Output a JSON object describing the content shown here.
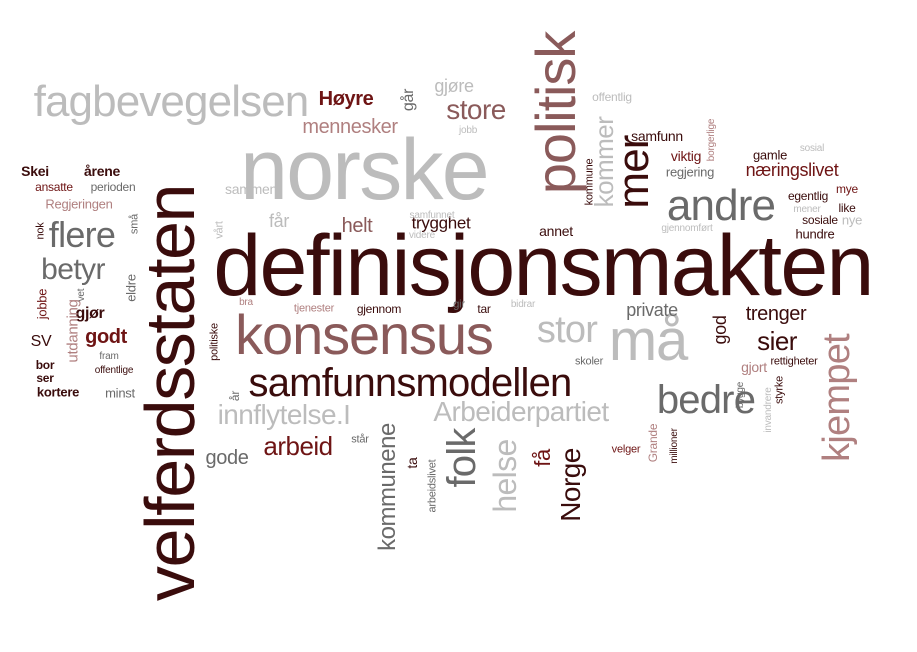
{
  "palette": {
    "dark": "#3a0c0c",
    "maroon": "#6e1414",
    "mauve": "#8a5a5a",
    "rose": "#b08080",
    "gray": "#6a6a6a",
    "light": "#bcbcbc"
  },
  "words": [
    {
      "text": "definisjonsmakten",
      "color": "dark"
    },
    {
      "text": "velferdsstaten",
      "color": "dark"
    },
    {
      "text": "norske",
      "color": "light"
    },
    {
      "text": "politisk",
      "color": "mauve"
    },
    {
      "text": "konsensus",
      "color": "mauve"
    },
    {
      "text": "samfunnsmodellen",
      "color": "dark"
    },
    {
      "text": "fagbevegelsen",
      "color": "light"
    },
    {
      "text": "andre",
      "color": "gray"
    },
    {
      "text": "mer",
      "color": "dark"
    },
    {
      "text": "kommer",
      "color": "light"
    },
    {
      "text": "stor",
      "color": "light"
    },
    {
      "text": "må",
      "color": "light"
    },
    {
      "text": "bedre",
      "color": "gray"
    },
    {
      "text": "kjempet",
      "color": "rose"
    },
    {
      "text": "flere",
      "color": "gray"
    },
    {
      "text": "betyr",
      "color": "gray"
    },
    {
      "text": "innflytelse.I",
      "color": "light"
    },
    {
      "text": "Arbeiderpartiet",
      "color": "light"
    },
    {
      "text": "arbeid",
      "color": "maroon"
    },
    {
      "text": "folk",
      "color": "gray"
    },
    {
      "text": "kommunene",
      "color": "gray"
    },
    {
      "text": "helse",
      "color": "light"
    },
    {
      "text": "Norge",
      "color": "dark"
    },
    {
      "text": "sier",
      "color": "dark"
    },
    {
      "text": "trenger",
      "color": "dark"
    },
    {
      "text": "Høyre",
      "color": "maroon"
    },
    {
      "text": "mennesker",
      "color": "rose"
    },
    {
      "text": "store",
      "color": "mauve"
    },
    {
      "text": "gjøre",
      "color": "light"
    },
    {
      "text": "går",
      "color": "gray"
    },
    {
      "text": "offentlig",
      "color": "light"
    },
    {
      "text": "helt",
      "color": "mauve"
    },
    {
      "text": "trygghet",
      "color": "dark"
    },
    {
      "text": "annet",
      "color": "dark"
    },
    {
      "text": "samfunnet",
      "color": "light"
    },
    {
      "text": "videre",
      "color": "light"
    },
    {
      "text": "får",
      "color": "light"
    },
    {
      "text": "sammen",
      "color": "light"
    },
    {
      "text": "vårt",
      "color": "light"
    },
    {
      "text": "Skei",
      "color": "dark"
    },
    {
      "text": "årene",
      "color": "dark"
    },
    {
      "text": "ansatte",
      "color": "maroon"
    },
    {
      "text": "perioden",
      "color": "gray"
    },
    {
      "text": "Regjeringen",
      "color": "rose"
    },
    {
      "text": "nok",
      "color": "dark"
    },
    {
      "text": "små",
      "color": "gray"
    },
    {
      "text": "godt",
      "color": "maroon"
    },
    {
      "text": "gjør",
      "color": "dark"
    },
    {
      "text": "SV",
      "color": "dark"
    },
    {
      "text": "jobbe",
      "color": "maroon"
    },
    {
      "text": "utdanning",
      "color": "rose"
    },
    {
      "text": "vet",
      "color": "gray"
    },
    {
      "text": "eldre",
      "color": "gray"
    },
    {
      "text": "bor",
      "color": "dark"
    },
    {
      "text": "ser",
      "color": "dark"
    },
    {
      "text": "kortere",
      "color": "dark"
    },
    {
      "text": "fram",
      "color": "gray"
    },
    {
      "text": "offentlige",
      "color": "dark"
    },
    {
      "text": "minst",
      "color": "gray"
    },
    {
      "text": "gode",
      "color": "gray"
    },
    {
      "text": "står",
      "color": "gray"
    },
    {
      "text": "år",
      "color": "gray"
    },
    {
      "text": "politiske",
      "color": "dark"
    },
    {
      "text": "bra",
      "color": "rose"
    },
    {
      "text": "tjenester",
      "color": "rose"
    },
    {
      "text": "gjennom",
      "color": "dark"
    },
    {
      "text": "gir",
      "color": "gray"
    },
    {
      "text": "tar",
      "color": "dark"
    },
    {
      "text": "bidrar",
      "color": "light"
    },
    {
      "text": "private",
      "color": "gray"
    },
    {
      "text": "ta",
      "color": "dark"
    },
    {
      "text": "arbeidslivet",
      "color": "gray"
    },
    {
      "text": "få",
      "color": "maroon"
    },
    {
      "text": "skoler",
      "color": "gray"
    },
    {
      "text": "jobb",
      "color": "light"
    },
    {
      "text": "samfunn",
      "color": "dark"
    },
    {
      "text": "kommune",
      "color": "dark"
    },
    {
      "text": "viktig",
      "color": "maroon"
    },
    {
      "text": "regjering",
      "color": "gray"
    },
    {
      "text": "næringslivet",
      "color": "maroon"
    },
    {
      "text": "gamle",
      "color": "dark"
    },
    {
      "text": "sosial",
      "color": "light"
    },
    {
      "text": "borgerlige",
      "color": "rose"
    },
    {
      "text": "egentlig",
      "color": "dark"
    },
    {
      "text": "mener",
      "color": "light"
    },
    {
      "text": "mye",
      "color": "maroon"
    },
    {
      "text": "like",
      "color": "dark"
    },
    {
      "text": "sosiale",
      "color": "dark"
    },
    {
      "text": "nye",
      "color": "light"
    },
    {
      "text": "hundre",
      "color": "dark"
    },
    {
      "text": "gjennomført",
      "color": "light"
    },
    {
      "text": "god",
      "color": "dark"
    },
    {
      "text": "gjort",
      "color": "rose"
    },
    {
      "text": "rettigheter",
      "color": "dark"
    },
    {
      "text": "bygge",
      "color": "gray"
    },
    {
      "text": "styrke",
      "color": "dark"
    },
    {
      "text": "invandrere",
      "color": "light"
    },
    {
      "text": "velger",
      "color": "maroon"
    },
    {
      "text": "Grande",
      "color": "rose"
    },
    {
      "text": "millioner",
      "color": "dark"
    }
  ]
}
